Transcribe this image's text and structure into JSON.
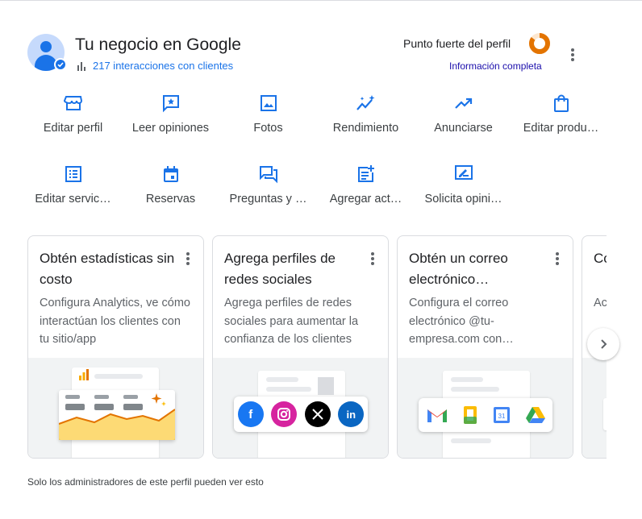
{
  "header": {
    "title": "Tu negocio en Google",
    "interactions": "217 interacciones con clientes",
    "strength_label": "Punto fuerte del perfil",
    "strength_status": "Información completa",
    "strength_fraction": 0.85
  },
  "actions": [
    {
      "label": "Editar perfil",
      "icon": "storefront-icon"
    },
    {
      "label": "Leer opiniones",
      "icon": "star-comment-icon"
    },
    {
      "label": "Fotos",
      "icon": "photo-icon"
    },
    {
      "label": "Rendimiento",
      "icon": "sparkle-chart-icon"
    },
    {
      "label": "Anunciarse",
      "icon": "trending-up-icon"
    },
    {
      "label": "Editar produ…",
      "icon": "shopping-bag-icon"
    },
    {
      "label": "Editar servic…",
      "icon": "list-icon"
    },
    {
      "label": "Reservas",
      "icon": "calendar-icon"
    },
    {
      "label": "Preguntas y …",
      "icon": "forum-icon"
    },
    {
      "label": "Agregar act…",
      "icon": "post-add-icon"
    },
    {
      "label": "Solicita opini…",
      "icon": "rate-review-icon"
    }
  ],
  "cards": [
    {
      "title": "Obtén estadísticas sin costo",
      "description": "Configura Analytics, ve cómo interactúan los clientes con tu sitio/app"
    },
    {
      "title": "Agrega perfiles de redes sociales",
      "description": "Agrega perfiles de redes sociales para aumentar la confianza de los clientes"
    },
    {
      "title": "Obtén un correo electrónico…",
      "description": "Configura el correo electrónico @tu-empresa.com con…"
    },
    {
      "title": "Co es",
      "description": "Ac ate"
    }
  ],
  "footer": "Solo los administradores de este perfil pueden ver esto",
  "colors": {
    "accent": "#1a73e8",
    "link_dark": "#1a0dab",
    "donut": "#e37400"
  }
}
